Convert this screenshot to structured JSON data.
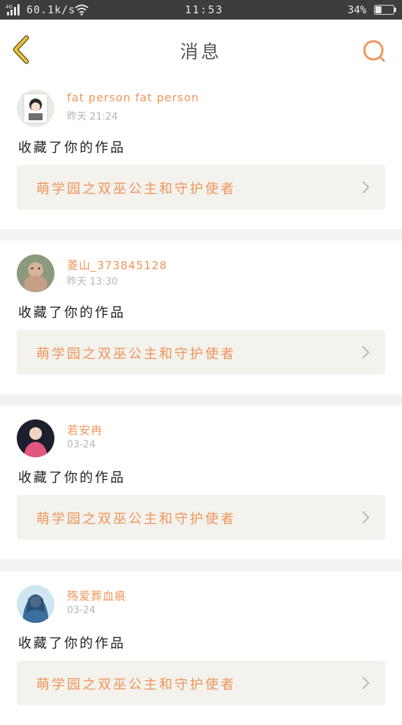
{
  "status_bar": {
    "network_type": "4G",
    "speed": "60.1k/s",
    "time": "11:53",
    "battery": "34%",
    "battery_level": 0.34
  },
  "header": {
    "title": "消息",
    "back_icon": "chevron-left-icon",
    "search_icon": "search-icon"
  },
  "colors": {
    "accent": "#f0955a",
    "back": "#f2c230",
    "card_bg": "#f3f2ed"
  },
  "messages": [
    {
      "user": "fat person fat person",
      "time": "昨天 21:24",
      "action": "收藏了你的作品",
      "work_title": "萌学园之双巫公主和守护使者"
    },
    {
      "user": "菱山_373845128",
      "time": "昨天 13:30",
      "action": "收藏了你的作品",
      "work_title": "萌学园之双巫公主和守护使者"
    },
    {
      "user": "若安冉",
      "time": "03-24",
      "action": "收藏了你的作品",
      "work_title": "萌学园之双巫公主和守护使者"
    },
    {
      "user": "殇爱葬血痕",
      "time": "03-24",
      "action": "收藏了你的作品",
      "work_title": "萌学园之双巫公主和守护使者"
    }
  ]
}
